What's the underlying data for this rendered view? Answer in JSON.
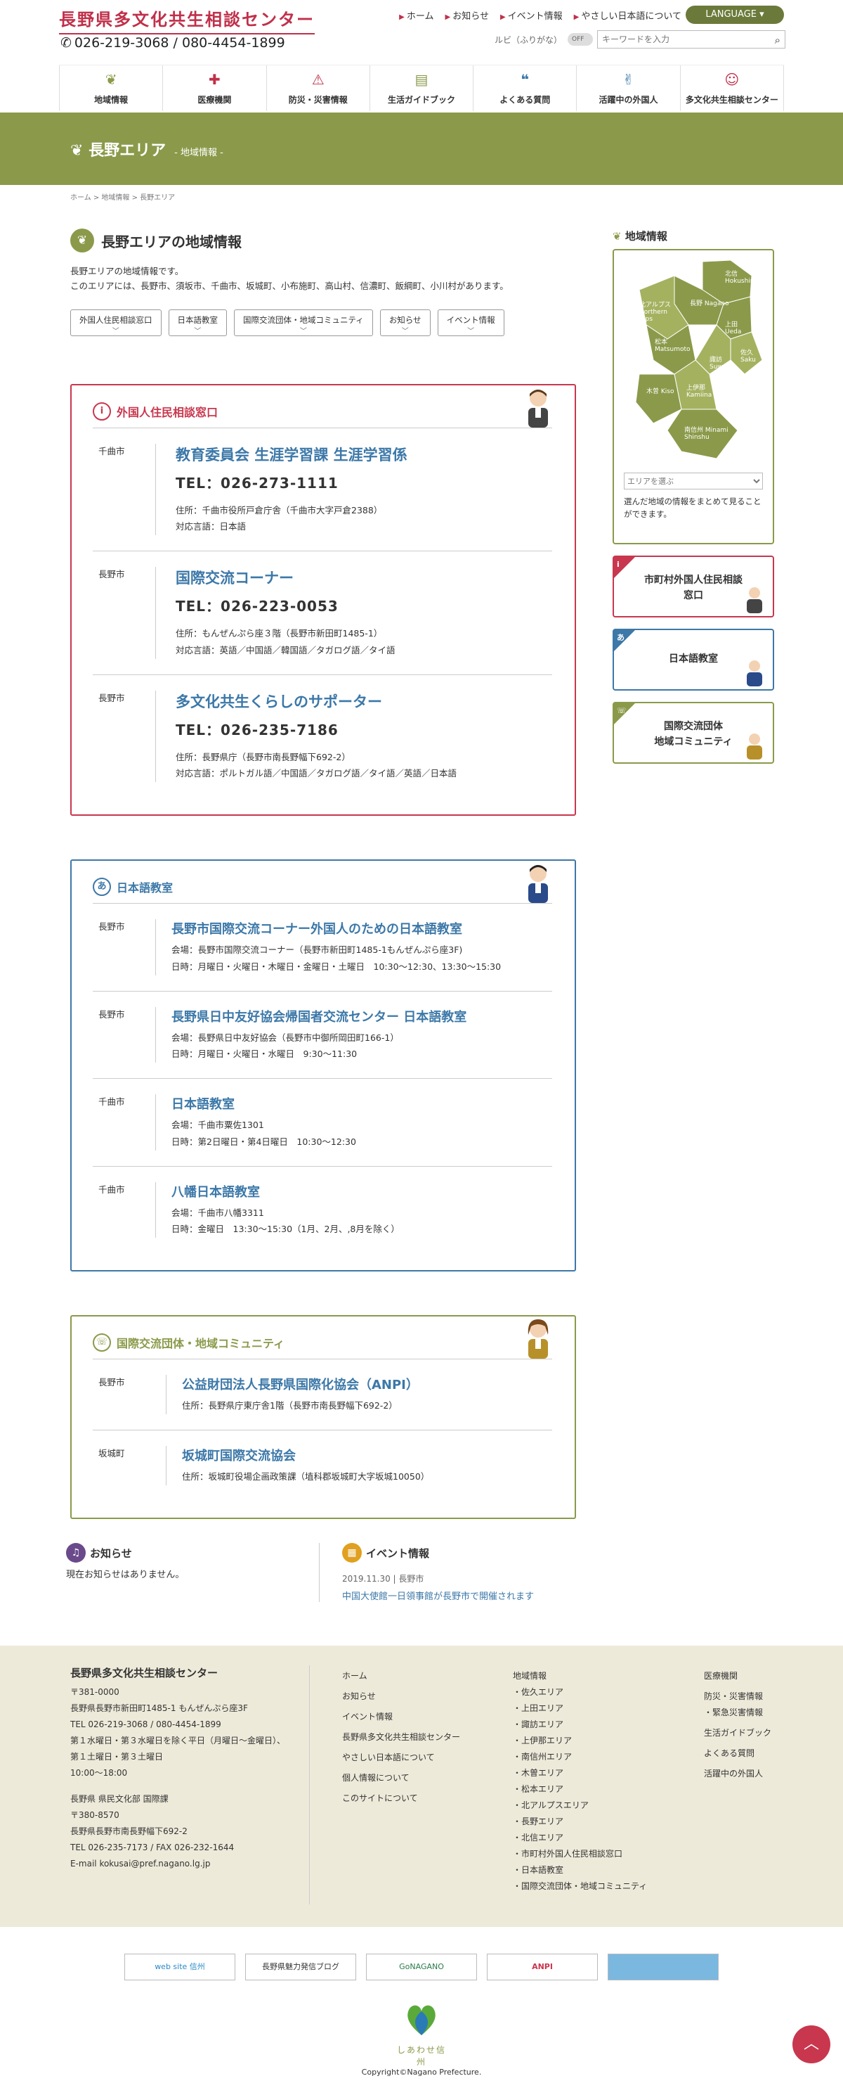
{
  "header": {
    "site_title": "長野県多文化共生相談センター",
    "tel": "026-219-3068 / 080-4454-1899",
    "top_links": [
      "ホーム",
      "お知らせ",
      "イベント情報",
      "やさしい日本語について"
    ],
    "language_label": "LANGUAGE",
    "ruby_label": "ルビ（ふりがな）",
    "ruby_toggle": "OFF",
    "search_placeholder": "キーワードを入力",
    "gnav": [
      "地域情報",
      "医療機関",
      "防災・災害情報",
      "生活ガイドブック",
      "よくある質問",
      "活躍中の外国人",
      "多文化共生相談センター"
    ]
  },
  "banner": {
    "title": "長野エリア",
    "sub": "- 地域情報 -"
  },
  "breadcrumb": "ホーム  >  地域情報  >  長野エリア",
  "main": {
    "title": "長野エリアの地域情報",
    "intro1": "長野エリアの地域情報です。",
    "intro2": "このエリアには、長野市、須坂市、千曲市、坂城町、小布施町、高山村、信濃町、飯綱町、小川村があります。",
    "tabs": [
      "外国人住民相談窓口",
      "日本語教室",
      "国際交流団体・地域コミュニティ",
      "お知らせ",
      "イベント情報"
    ]
  },
  "consult": {
    "heading": "外国人住民相談窓口",
    "rows": [
      {
        "city": "千曲市",
        "name": "教育委員会 生涯学習課 生涯学習係",
        "tel": "TEL：026-273-1111",
        "addr": "住所：千曲市役所戸倉庁舎（千曲市大字戸倉2388）",
        "lang": "対応言語：日本語"
      },
      {
        "city": "長野市",
        "name": "国際交流コーナー",
        "tel": "TEL：026-223-0053",
        "addr": "住所：もんぜんぷら座３階（長野市新田町1485-1）",
        "lang": "対応言語：英語／中国語／韓国語／タガログ語／タイ語"
      },
      {
        "city": "長野市",
        "name": "多文化共生くらしのサポーター",
        "tel": "TEL：026-235-7186",
        "addr": "住所：長野県庁（長野市南長野幅下692-2）",
        "lang": "対応言語：ポルトガル語／中国語／タガログ語／タイ語／英語／日本語"
      }
    ]
  },
  "classes": {
    "heading": "日本語教室",
    "rows": [
      {
        "city": "長野市",
        "name": "長野市国際交流コーナー外国人のための日本語教室",
        "venue": "会場：長野市国際交流コーナー（長野市新田町1485-1もんぜんぷら座3F)",
        "time": "日時：月曜日・火曜日・木曜日・金曜日・土曜日　10:30〜12:30、13:30〜15:30"
      },
      {
        "city": "長野市",
        "name": "長野県日中友好協会帰国者交流センター 日本語教室",
        "venue": "会場：長野県日中友好協会（長野市中御所岡田町166-1）",
        "time": "日時：月曜日・火曜日・水曜日　9:30〜11:30"
      },
      {
        "city": "千曲市",
        "name": "日本語教室",
        "venue": "会場：千曲市粟佐1301",
        "time": "日時：第2日曜日・第4日曜日　10:30〜12:30"
      },
      {
        "city": "千曲市",
        "name": "八幡日本語教室",
        "venue": "会場：千曲市八幡3311",
        "time": "日時：金曜日　13:30〜15:30（1月、2月、,8月を除く）"
      }
    ]
  },
  "groups": {
    "heading": "国際交流団体・地域コミュニティ",
    "rows": [
      {
        "city": "長野市",
        "name": "公益財団法人長野県国際化協会（ANPI）",
        "addr": "住所：長野県庁東庁舎1階（長野市南長野幅下692-2）"
      },
      {
        "city": "坂城町",
        "name": "坂城町国際交流協会",
        "addr": "住所：坂城町役場企画政策課（埴科郡坂城町大字坂城10050）"
      }
    ]
  },
  "side": {
    "heading": "地域情報",
    "map_labels": [
      "北信 Hokushin",
      "長野 Nagano",
      "北アルプス Northern Alps",
      "上田 Ueda",
      "佐久 Saku",
      "松本 Matsumoto",
      "諏訪 Suwa",
      "木曽 Kiso",
      "上伊那 Kamiina",
      "南信州 Minami Shinshu"
    ],
    "select": "エリアを選ぶ",
    "desc": "選んだ地域の情報をまとめて見ることができます。",
    "btn1": "市町村外国人住民相談窓口",
    "btn2": "日本語教室",
    "btn3a": "国際交流団体",
    "btn3b": "地域コミュニティ"
  },
  "news": {
    "heading": "お知らせ",
    "empty": "現在お知らせはありません。",
    "ev_heading": "イベント情報",
    "ev_date": "2019.11.30 | 長野市",
    "ev_title": "中国大使館一日領事館が長野市で開催されます"
  },
  "footer": {
    "org": "長野県多文化共生相談センター",
    "lines1": [
      "〒381-0000",
      "長野県長野市新田町1485-1 もんぜんぷら座3F",
      "TEL 026-219-3068 / 080-4454-1899",
      "第１水曜日・第３水曜日を除く平日（月曜日〜金曜日）、",
      "第１土曜日・第３土曜日",
      "10:00〜18:00"
    ],
    "lines2": [
      "長野県 県民文化部 国際課",
      "〒380-8570",
      "長野県長野市南長野幅下692-2",
      "TEL 026-235-7173 / FAX 026-232-1644",
      "E-mail kokusai@pref.nagano.lg.jp"
    ],
    "col2": [
      "ホーム",
      "お知らせ",
      "イベント情報",
      "長野県多文化共生相談センター",
      "やさしい日本語について",
      "個人情報について",
      "このサイトについて"
    ],
    "col3_head": "地域情報",
    "col3": [
      "・佐久エリア",
      "・上田エリア",
      "・諏訪エリア",
      "・上伊那エリア",
      "・南信州エリア",
      "・木曽エリア",
      "・松本エリア",
      "・北アルプスエリア",
      "・長野エリア",
      "・北信エリア",
      "・市町村外国人住民相談窓口",
      "・日本語教室",
      "・国際交流団体・地域コミュニティ"
    ],
    "col4": [
      "医療機関",
      "防災・災害情報",
      "・緊急災害情報",
      "生活ガイドブック",
      "よくある質問",
      "活躍中の外国人"
    ],
    "banners": [
      "web site 信州",
      "長野県魅力発信ブログ",
      "GoNAGANO",
      "ANPI",
      ""
    ],
    "logo_text": "しあわせ信州",
    "copyright": "Copyright©Nagano Prefecture."
  }
}
